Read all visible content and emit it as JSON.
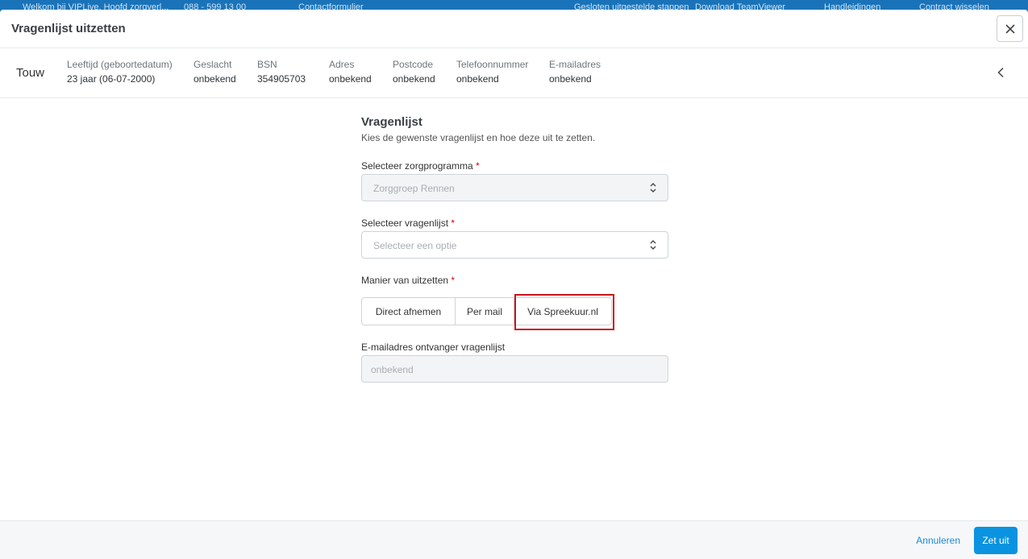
{
  "topbar": {
    "items": [
      "Welkom bij VIPLive, Hoofd zorgverl...",
      "088 - 599 13 00",
      "Contactformulier",
      "Gesloten uitgestelde stappen",
      "Download TeamViewer",
      "Handleidingen",
      "Contract wisselen"
    ]
  },
  "modal": {
    "title": "Vragenlijst uitzetten"
  },
  "patient": {
    "name": "Touw",
    "fields": [
      {
        "label": "Leeftijd (geboortedatum)",
        "value": "23 jaar (06-07-2000)"
      },
      {
        "label": "Geslacht",
        "value": "onbekend"
      },
      {
        "label": "BSN",
        "value": "354905703"
      },
      {
        "label": "Adres",
        "value": "onbekend"
      },
      {
        "label": "Postcode",
        "value": "onbekend"
      },
      {
        "label": "Telefoonnummer",
        "value": "onbekend"
      },
      {
        "label": "E-mailadres",
        "value": "onbekend"
      }
    ]
  },
  "form": {
    "title": "Vragenlijst",
    "subtitle": "Kies de gewenste vragenlijst en hoe deze uit te zetten.",
    "zorgprogramma": {
      "label": "Selecteer zorgprogramma",
      "required": "*",
      "value": "Zorggroep Rennen"
    },
    "vragenlijst": {
      "label": "Selecteer vragenlijst",
      "required": "*",
      "placeholder": "Selecteer een optie"
    },
    "manier": {
      "label": "Manier van uitzetten",
      "required": "*",
      "options": [
        "Direct afnemen",
        "Per mail",
        "Via Spreekuur.nl"
      ]
    },
    "email": {
      "label": "E-mailadres ontvanger vragenlijst",
      "placeholder": "onbekend"
    }
  },
  "footer": {
    "cancel": "Annuleren",
    "submit": "Zet uit"
  },
  "colors": {
    "primary": "#0a93e0",
    "highlight": "#c9151b",
    "required": "#d0021b"
  }
}
